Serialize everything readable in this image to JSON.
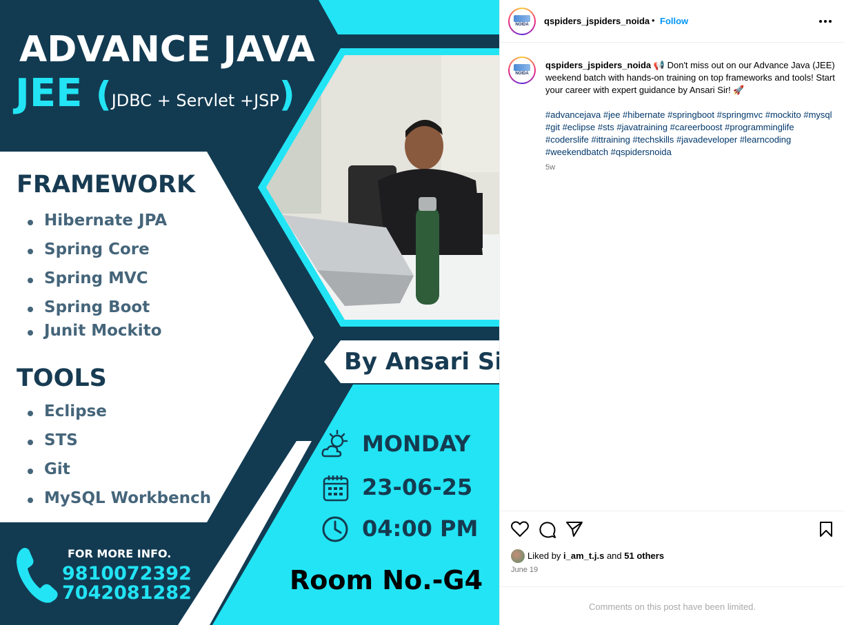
{
  "poster": {
    "title_line1": "ADVANCE JAVA",
    "title_line2": "JEE",
    "title_paren_open": "(",
    "title_sub": "JDBC + Servlet +JSP",
    "title_paren_close": ")",
    "framework_heading": "FRAMEWORK",
    "framework_items": [
      "Hibernate JPA",
      "Spring Core",
      "Spring MVC",
      "Spring Boot",
      "Junit Mockito"
    ],
    "tools_heading": "TOOLS",
    "tools_items": [
      "Eclipse",
      "STS",
      "Git",
      "MySQL Workbench"
    ],
    "trainer": "By Ansari Sir",
    "day": "MONDAY",
    "date": "23-06-25",
    "time": "04:00 PM",
    "room": "Room No.-G4",
    "more_info": "FOR MORE INFO.",
    "phone1": "9810072392",
    "phone2": "7042081282",
    "colors": {
      "navy": "#123b52",
      "cyan": "#22e4f4",
      "text_gray": "#45657a"
    }
  },
  "post": {
    "account": "qspiders_jspiders_noida",
    "avatar_text": "NOIDA",
    "follow_label": "Follow",
    "separator": "•",
    "more_icon": "more-options-icon",
    "caption_text": "📢 Don't miss out on our Advance Java (JEE) weekend batch with hands-on training on top frameworks and tools! Start your career with expert guidance by Ansari Sir! 🚀",
    "hashtags": "#advancejava #jee #hibernate #springboot #springmvc #mockito #mysql #git #eclipse #sts #javatraining #careerboost #programminglife #coderslife #ittraining #techskills #javadeveloper #learncoding #weekendbatch #qspidersnoida",
    "time_ago": "5w",
    "liked_by_prefix": "Liked by",
    "liked_by_user": "i_am_t.j.s",
    "liked_by_and": "and",
    "liked_by_others": "51 others",
    "date": "June 19",
    "comments_notice": "Comments on this post have been limited.",
    "colors": {
      "link": "#0095f6",
      "hashtag": "#00376b",
      "muted": "#737373"
    }
  }
}
